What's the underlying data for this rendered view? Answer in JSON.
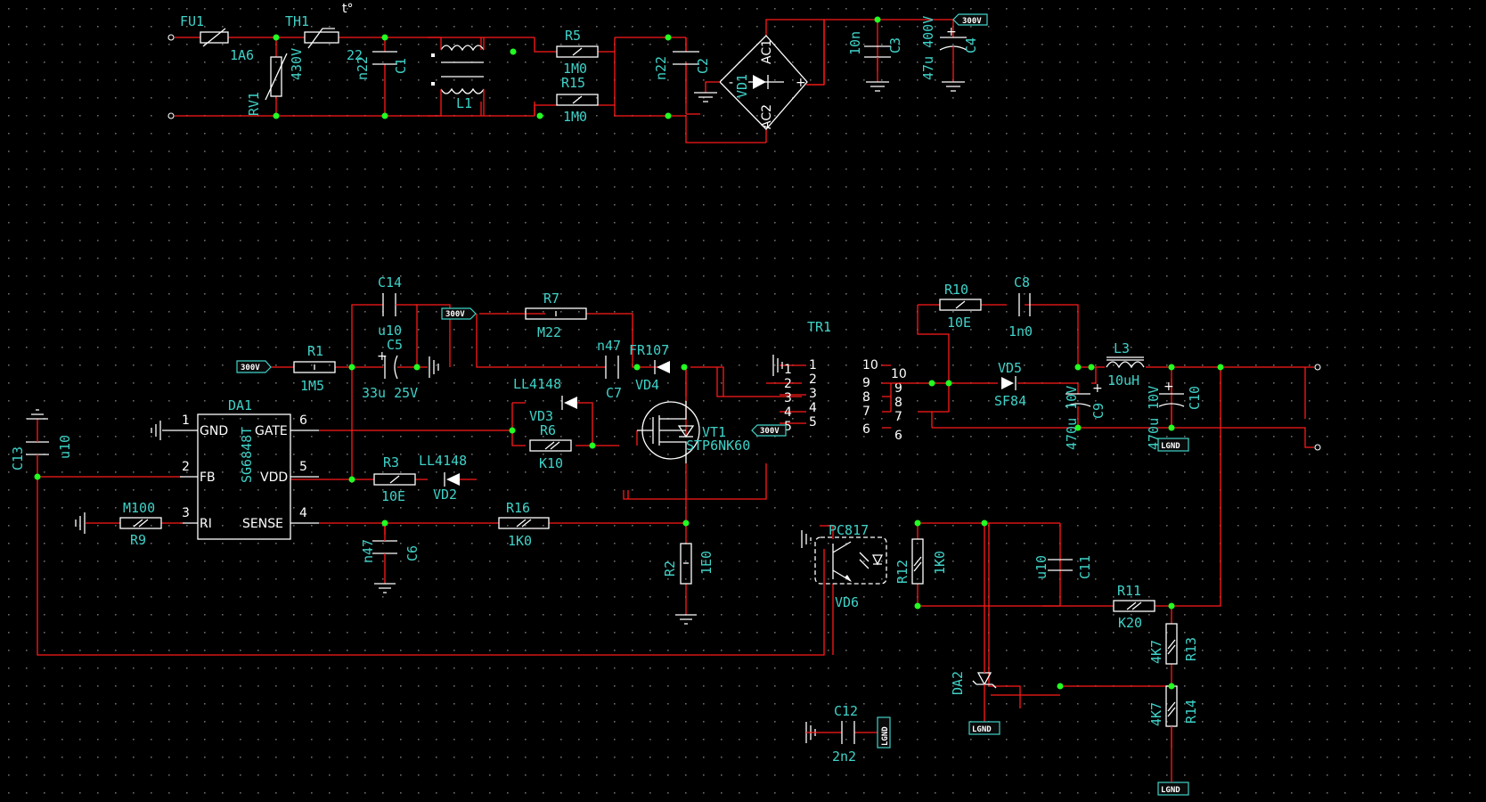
{
  "fuse": {
    "ref": "FU1",
    "value": "1A6"
  },
  "thermistor": {
    "ref": "TH1",
    "value": "22"
  },
  "varistor": {
    "ref": "RV1",
    "value": "430V"
  },
  "c1": {
    "ref": "C1",
    "value": "n22"
  },
  "l1": {
    "ref": "L1"
  },
  "r5": {
    "ref": "R5",
    "value": "1M0"
  },
  "r15": {
    "ref": "R15",
    "value": "1M0"
  },
  "c2": {
    "ref": "C2",
    "value": "n22"
  },
  "vd1": {
    "ref": "VD1",
    "ac1": "AC1",
    "ac2": "AC2",
    "plus": "+",
    "minus": "-"
  },
  "c3": {
    "ref": "C3",
    "value": "10n"
  },
  "c4": {
    "ref": "C4",
    "value": "47u 400V"
  },
  "net_300v": "300V",
  "net_lgnd": "LGND",
  "c14": {
    "ref": "C14",
    "value": "u10"
  },
  "c5": {
    "ref": "C5",
    "value": "33u 25V"
  },
  "r1": {
    "ref": "R1",
    "value": "1M5"
  },
  "r7": {
    "ref": "R7",
    "value": "M22"
  },
  "c7": {
    "ref": "C7",
    "value": "n47"
  },
  "vd4": {
    "ref": "VD4",
    "value": "FR107"
  },
  "vd3": {
    "ref": "VD3",
    "value": "LL4148"
  },
  "r6": {
    "ref": "R6",
    "value": "K10"
  },
  "vt1": {
    "ref": "VT1",
    "value": "STP6NK60"
  },
  "tr1": {
    "ref": "TR1",
    "pins_left": [
      "1",
      "2",
      "3",
      "4",
      "5"
    ],
    "pins_right": [
      "10",
      "9",
      "8",
      "7",
      "6"
    ]
  },
  "c13": {
    "ref": "C13",
    "value": "u10"
  },
  "da1": {
    "ref": "DA1",
    "part": "SG6848T",
    "pins": [
      {
        "num": "1",
        "name": "GND"
      },
      {
        "num": "2",
        "name": "FB"
      },
      {
        "num": "3",
        "name": "RI"
      },
      {
        "num": "6",
        "name": "GATE"
      },
      {
        "num": "5",
        "name": "VDD"
      },
      {
        "num": "4",
        "name": "SENSE"
      }
    ]
  },
  "r3": {
    "ref": "R3",
    "value": "10E"
  },
  "vd2": {
    "ref": "VD2",
    "value": "LL4148"
  },
  "r9": {
    "ref": "R9",
    "value": "M100"
  },
  "c6": {
    "ref": "C6",
    "value": "n47"
  },
  "r16": {
    "ref": "R16",
    "value": "1K0"
  },
  "r2": {
    "ref": "R2",
    "value": "1E0"
  },
  "r10": {
    "ref": "R10",
    "value": "10E"
  },
  "c8": {
    "ref": "C8",
    "value": "1n0"
  },
  "vd5": {
    "ref": "VD5",
    "value": "SF84"
  },
  "c9": {
    "ref": "C9",
    "value": "470u 10V"
  },
  "l3": {
    "ref": "L3",
    "value": "10uH"
  },
  "c10": {
    "ref": "C10",
    "value": "470u 10V"
  },
  "vd6": {
    "ref": "VD6",
    "value": "PC817"
  },
  "r12": {
    "ref": "R12",
    "value": "1K0"
  },
  "c11": {
    "ref": "C11",
    "value": "u10"
  },
  "r11": {
    "ref": "R11",
    "value": "K20"
  },
  "r13": {
    "ref": "R13",
    "value": "4K7"
  },
  "r14": {
    "ref": "R14",
    "value": "4K7"
  },
  "da2": {
    "ref": "DA2"
  },
  "c12": {
    "ref": "C12",
    "value": "2n2"
  },
  "colors": {
    "background": "#000000",
    "wire": "#ff1a1a",
    "symbol": "#ffffff",
    "label": "#3fd2c8",
    "junction": "#22ff22"
  }
}
